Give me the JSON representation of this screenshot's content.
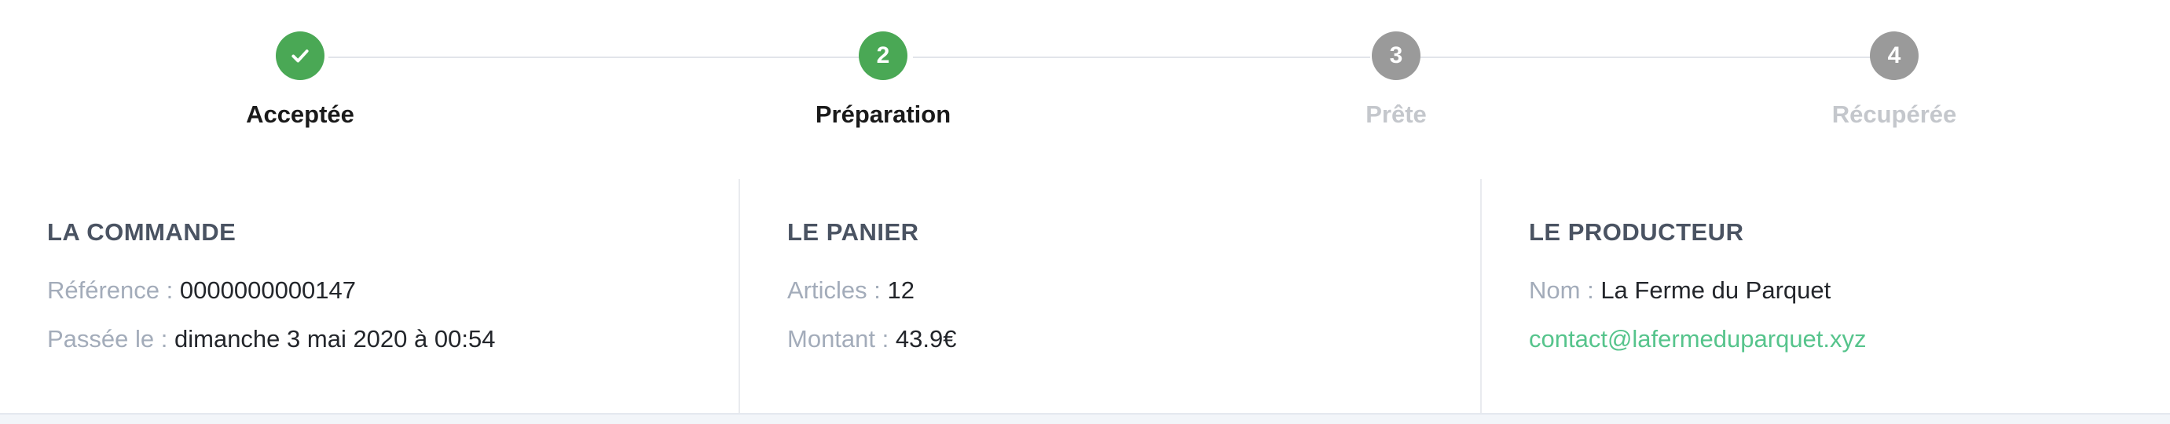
{
  "stepper": {
    "steps": [
      {
        "marker": "✔",
        "label": "Acceptée",
        "state": "done"
      },
      {
        "marker": "2",
        "label": "Préparation",
        "state": "done"
      },
      {
        "marker": "3",
        "label": "Prête",
        "state": "todo"
      },
      {
        "marker": "4",
        "label": "Récupérée",
        "state": "todo"
      }
    ],
    "colors": {
      "done": "#4aa855",
      "todo": "#9a9a9a"
    },
    "icons": {
      "step1": "check-icon"
    }
  },
  "order": {
    "title": "LA COMMANDE",
    "reference_label": "Référence :",
    "reference_value": "0000000000147",
    "date_label": "Passée le :",
    "date_value": "dimanche 3 mai 2020 à 00:54"
  },
  "basket": {
    "title": "LE PANIER",
    "items_label": "Articles :",
    "items_value": "12",
    "amount_label": "Montant :",
    "amount_value": "43.9€"
  },
  "producer": {
    "title": "LE PRODUCTEUR",
    "name_label": "Nom :",
    "name_value": "La Ferme du Parquet",
    "email": "contact@lafermeduparquet.xyz"
  },
  "theme": {
    "accent_green": "#4aa855",
    "link_green": "#56c48c"
  }
}
